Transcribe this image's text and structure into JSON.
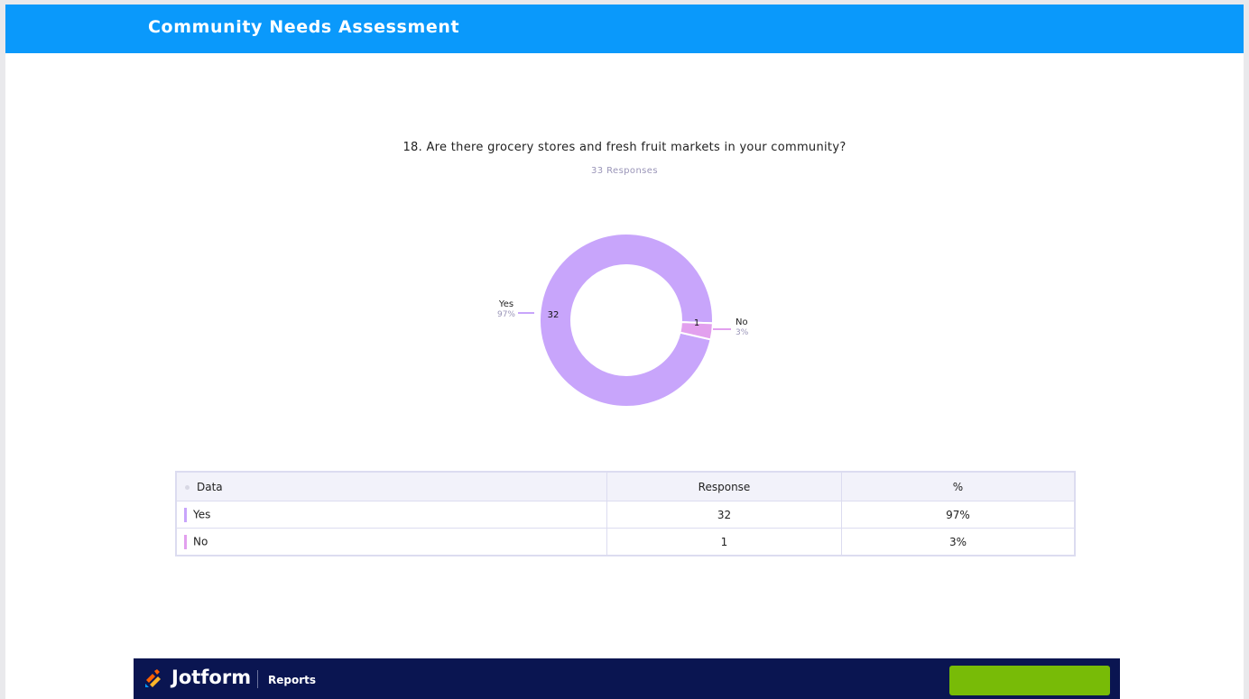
{
  "header": {
    "title": "Community Needs Assessment"
  },
  "question": {
    "title": "18. Are there grocery stores and fresh fruit markets in your community?",
    "responses_label": "33 Responses"
  },
  "colors": {
    "yes": "#c8a5fb",
    "no": "#e2a0ee",
    "header": "#0a99fb",
    "footer": "#0a1551",
    "cta": "#78bb07"
  },
  "chart_data": {
    "type": "pie",
    "donut": true,
    "total": 33,
    "slices": [
      {
        "label": "Yes",
        "value": 32,
        "percent": "97%"
      },
      {
        "label": "No",
        "value": 1,
        "percent": "3%"
      }
    ]
  },
  "table": {
    "headers": [
      "Data",
      "Response",
      "%"
    ],
    "rows": [
      {
        "label": "Yes",
        "response": "32",
        "percent": "97%"
      },
      {
        "label": "No",
        "response": "1",
        "percent": "3%"
      }
    ]
  },
  "footer": {
    "brand": "Jotform",
    "product": "Reports"
  }
}
